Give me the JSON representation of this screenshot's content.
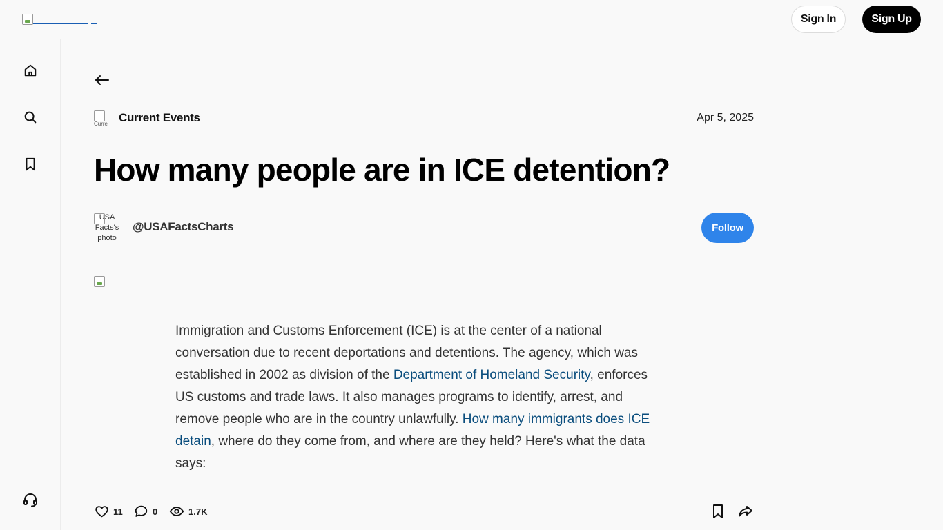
{
  "header": {
    "sign_in_label": "Sign In",
    "sign_up_label": "Sign Up"
  },
  "sidebar": {
    "items": [
      {
        "icon": "home-icon"
      },
      {
        "icon": "search-icon"
      },
      {
        "icon": "bookmark-icon"
      }
    ],
    "footer_icon": "headset-icon"
  },
  "article": {
    "category": "Current Events",
    "category_image_alt": "Curre",
    "date": "Apr 5, 2025",
    "title": "How many people are in ICE detention?",
    "author_image_alt": "USA Facts's photo",
    "author_handle": "@USAFactsCharts",
    "follow_label": "Follow",
    "body": {
      "p1_a": "Immigration and Customs Enforcement (ICE) is at the center of a national conversation due to recent deportations and detentions. The agency, which was established in 2002 as division of the ",
      "link1": "Department of Homeland Security",
      "p1_b": ", enforces US customs and trade laws. It also manages programs to identify, arrest, and remove people who are in the country unlawfully. ",
      "link2": "How many immigrants does ICE detain",
      "p1_c": ", where do they come from, and where are they held? Here's what the data says:"
    }
  },
  "actions": {
    "likes": "11",
    "comments": "0",
    "views": "1.7K"
  },
  "colors": {
    "follow_bg": "#2f84ea",
    "link": "#0a4d7d",
    "signup_bg": "#000000"
  }
}
